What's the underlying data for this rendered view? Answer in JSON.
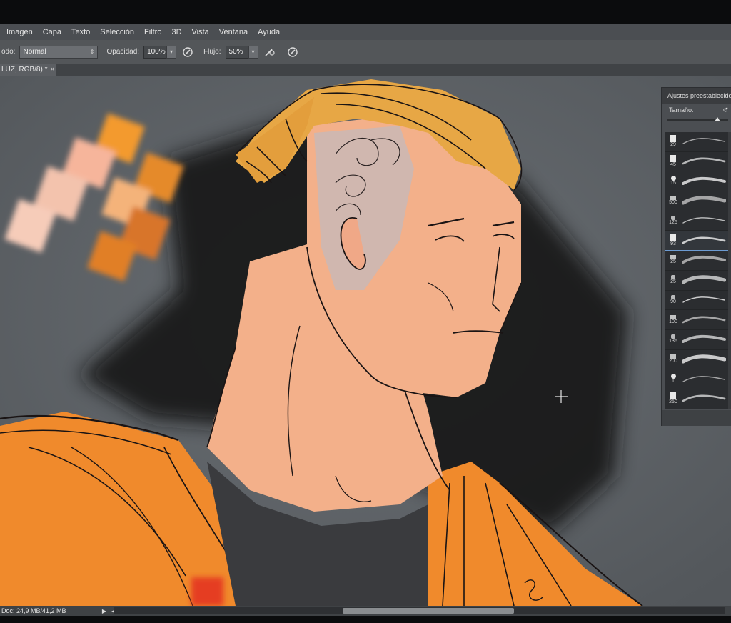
{
  "menubar": {
    "items": [
      "Imagen",
      "Capa",
      "Texto",
      "Selección",
      "Filtro",
      "3D",
      "Vista",
      "Ventana",
      "Ayuda"
    ]
  },
  "options": {
    "mode_label": "odo:",
    "mode_value": "Normal",
    "opacity_label": "Opacidad:",
    "opacity_value": "100%",
    "flow_label": "Flujo:",
    "flow_value": "50%"
  },
  "document": {
    "tab_label": "LUZ, RGB/8) *",
    "close_glyph": "×"
  },
  "status": {
    "doc_info": "Doc: 24,9 MB/41,2 MB"
  },
  "brush_panel": {
    "title": "Ajustes preestablecido",
    "size_label": "Tamaño:",
    "presets": [
      {
        "num": "29",
        "tip": "square"
      },
      {
        "num": "45",
        "tip": "square"
      },
      {
        "num": "15",
        "tip": "round"
      },
      {
        "num": "500",
        "tip": "bristle"
      },
      {
        "num": "125",
        "tip": "scatter"
      },
      {
        "num": "93",
        "tip": "square"
      },
      {
        "num": "25",
        "tip": "bristle"
      },
      {
        "num": "25",
        "tip": "scatter"
      },
      {
        "num": "90",
        "tip": "scatter"
      },
      {
        "num": "100",
        "tip": "bristle"
      },
      {
        "num": "136",
        "tip": "scatter"
      },
      {
        "num": "200",
        "tip": "bristle"
      },
      {
        "num": "1",
        "tip": "round"
      },
      {
        "num": "250",
        "tip": "square"
      }
    ],
    "selected_index": 5
  },
  "colors": {
    "ui_bg": "#4b4e52",
    "canvas_bg": "#5f6468",
    "skin": "#f3b08a",
    "hair": "#e7a745",
    "jacket": "#f08a2c",
    "shirt": "#3a3b3e",
    "line": "#1a1414"
  }
}
